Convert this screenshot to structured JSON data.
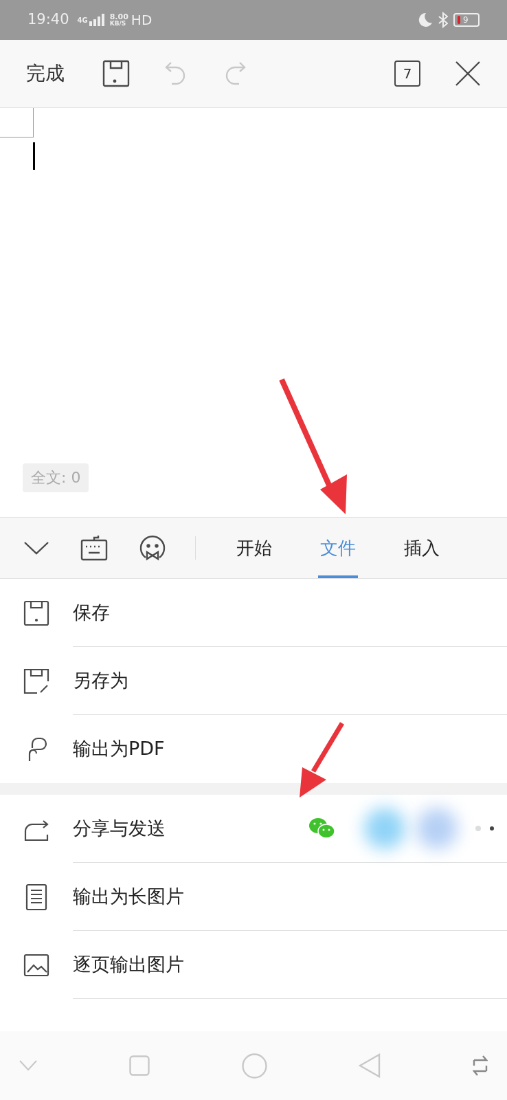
{
  "status_bar": {
    "time": "19:40",
    "network": "4G",
    "speed_value": "8.00",
    "speed_unit": "KB/S",
    "hd": "HD",
    "battery": "9"
  },
  "toolbar": {
    "done": "完成",
    "page_count": "7",
    "undo_disabled": true,
    "redo_disabled": true
  },
  "document": {
    "word_count": "全文: 0"
  },
  "tabs": [
    {
      "label": "开始",
      "selected": false
    },
    {
      "label": "文件",
      "selected": true
    },
    {
      "label": "插入",
      "selected": false
    }
  ],
  "menu": [
    {
      "kind": "save",
      "label": "保存"
    },
    {
      "kind": "save_as",
      "label": "另存为"
    },
    {
      "kind": "pdf",
      "label": "输出为PDF"
    },
    {
      "kind": "share",
      "label": "分享与发送"
    },
    {
      "kind": "long_image",
      "label": "输出为长图片"
    },
    {
      "kind": "page_images",
      "label": "逐页输出图片"
    }
  ]
}
